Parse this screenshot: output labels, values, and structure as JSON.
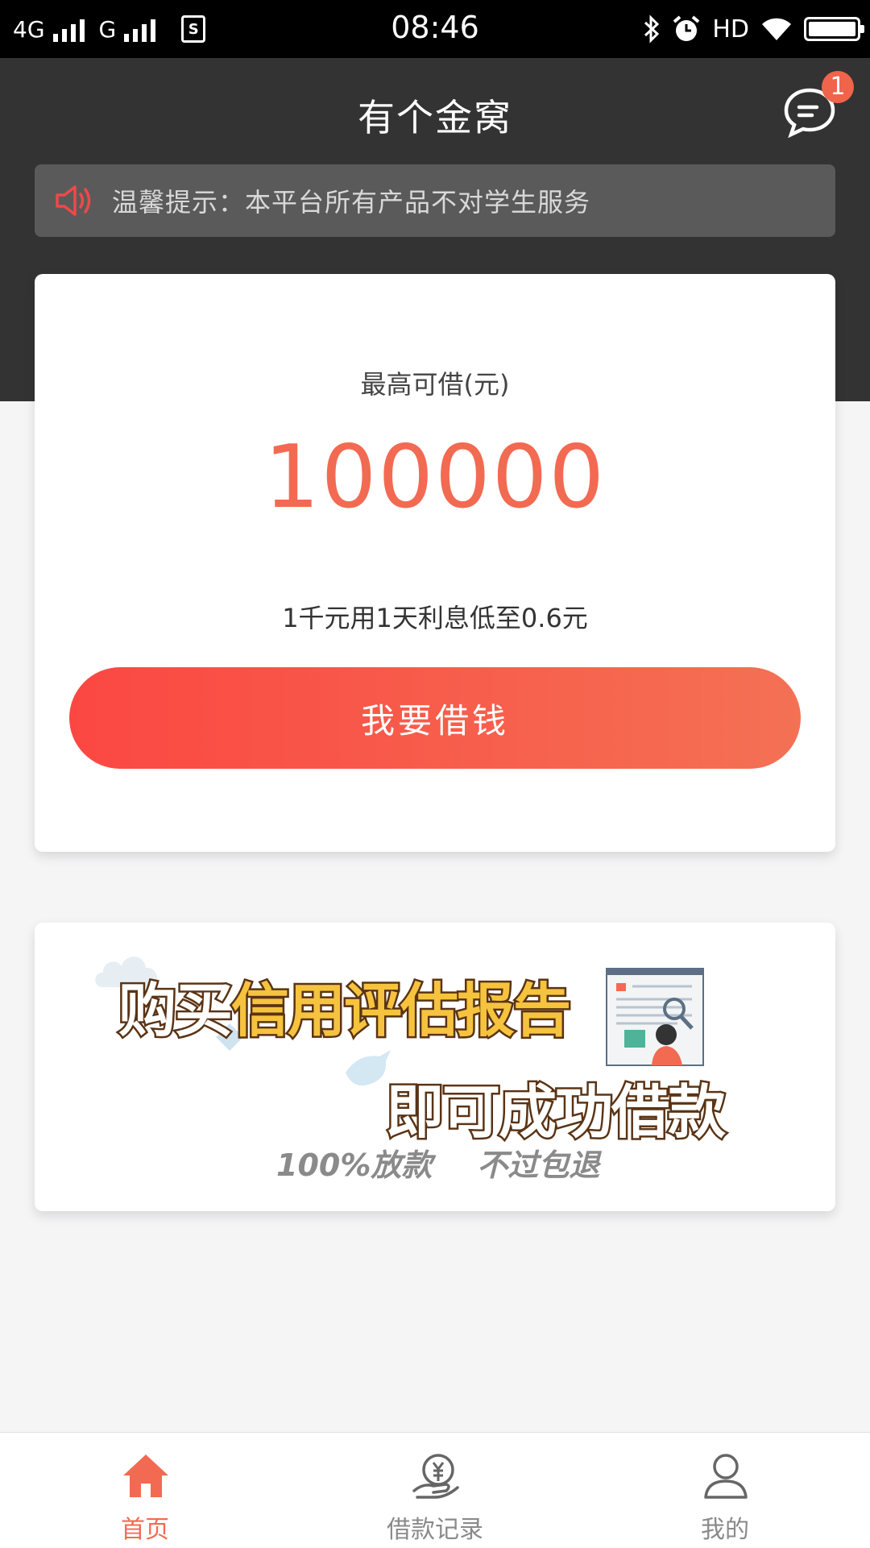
{
  "status_bar": {
    "network1": "4G",
    "network2": "G",
    "sim_icon": "S",
    "time": "08:46",
    "hd": "HD",
    "icons": [
      "bluetooth-icon",
      "alarm-icon",
      "wifi-icon",
      "battery-icon"
    ]
  },
  "header": {
    "title": "有个金窝",
    "message_badge": "1",
    "notice": "温馨提示：本平台所有产品不对学生服务"
  },
  "loan": {
    "label": "最高可借(元)",
    "amount": "100000",
    "rate_text": "1千元用1天利息低至0.6元",
    "button_label": "我要借钱"
  },
  "banner": {
    "line1_white": "购买",
    "line1_yellow": "信用评估报告",
    "line2": "即可成功借款",
    "sub1": "100%放款",
    "sub2": "不过包退"
  },
  "tabs": [
    {
      "label": "首页",
      "icon": "home-icon",
      "active": true
    },
    {
      "label": "借款记录",
      "icon": "loan-record-icon",
      "active": false
    },
    {
      "label": "我的",
      "icon": "user-icon",
      "active": false
    }
  ],
  "colors": {
    "accent": "#f26a52",
    "button_gradient_start": "#fb4742",
    "button_gradient_end": "#f47154",
    "header_bg": "#333333",
    "notice_bg": "#5a5a5a"
  }
}
